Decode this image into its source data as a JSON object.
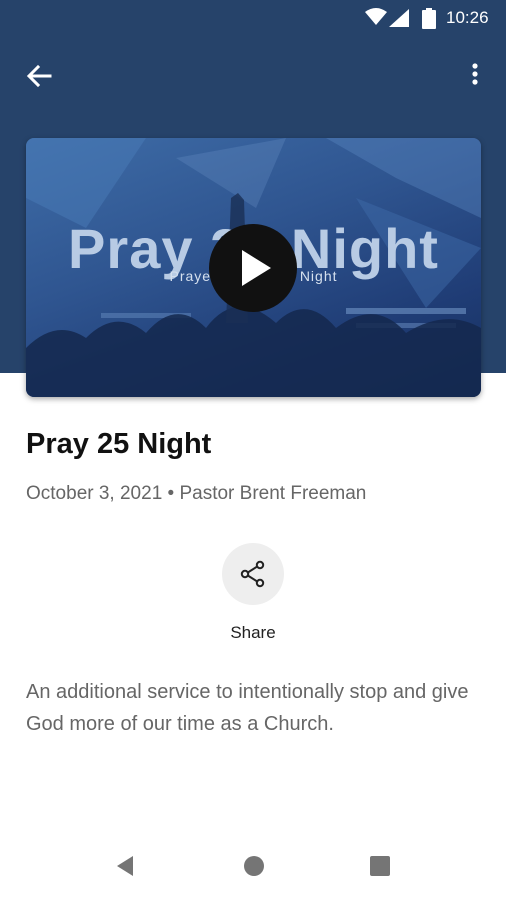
{
  "status_bar": {
    "time": "10:26",
    "icons": [
      "wifi-icon",
      "signal-icon",
      "battery-icon"
    ]
  },
  "app_bar": {
    "back_icon": "arrow-back-icon",
    "menu_icon": "more-vert-icon"
  },
  "video": {
    "thumbnail_title": "Pray 25 Night",
    "thumbnail_subtitle": "Prayer & Worship Night",
    "play_icon": "play-icon"
  },
  "sermon": {
    "title": "Pray 25 Night",
    "meta": "October 3, 2021 • Pastor Brent Freeman",
    "description": "An additional service to intentionally stop and give God more of our time as a Church."
  },
  "actions": {
    "share_label": "Share",
    "share_icon": "share-icon"
  },
  "nav_bar": {
    "icons": [
      "nav-back-icon",
      "nav-home-icon",
      "nav-recents-icon"
    ]
  },
  "colors": {
    "header": "#26436a",
    "text_primary": "#111111",
    "text_secondary": "#666666",
    "share_bg": "#eeeeee"
  }
}
